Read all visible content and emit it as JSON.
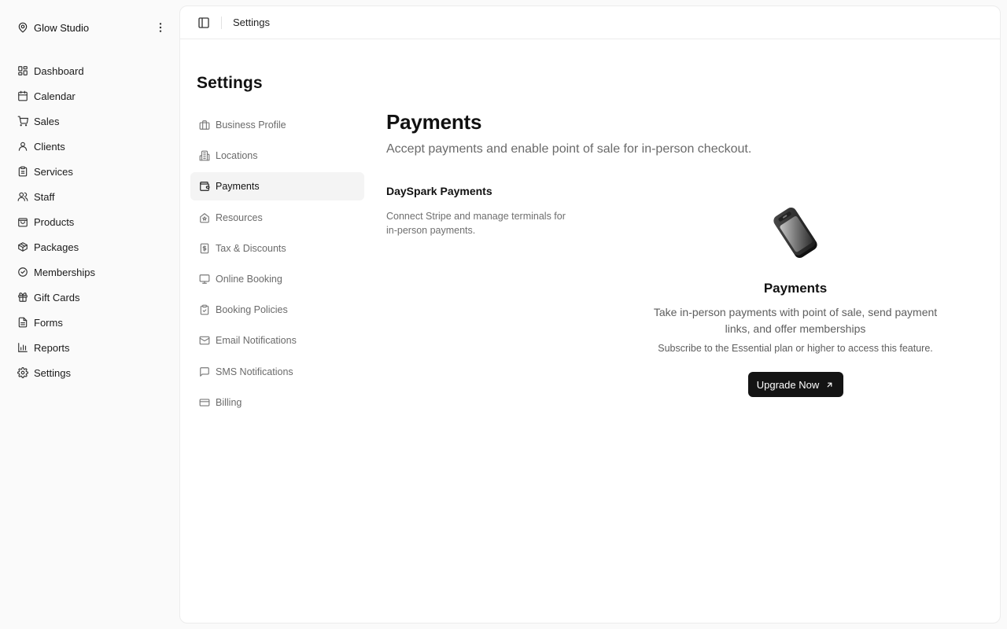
{
  "workspace": {
    "name": "Glow Studio",
    "icon": "map-pin-icon"
  },
  "sidebar": {
    "items": [
      {
        "label": "Dashboard",
        "icon": "dashboard-icon"
      },
      {
        "label": "Calendar",
        "icon": "calendar-icon"
      },
      {
        "label": "Sales",
        "icon": "cart-icon"
      },
      {
        "label": "Clients",
        "icon": "user-icon"
      },
      {
        "label": "Services",
        "icon": "clipboard-icon"
      },
      {
        "label": "Staff",
        "icon": "users-icon"
      },
      {
        "label": "Products",
        "icon": "shopping-bag-icon"
      },
      {
        "label": "Packages",
        "icon": "package-icon"
      },
      {
        "label": "Memberships",
        "icon": "badge-check-icon"
      },
      {
        "label": "Gift Cards",
        "icon": "gift-icon"
      },
      {
        "label": "Forms",
        "icon": "file-text-icon"
      },
      {
        "label": "Reports",
        "icon": "bar-chart-icon"
      },
      {
        "label": "Settings",
        "icon": "gear-icon"
      }
    ]
  },
  "topbar": {
    "breadcrumb": "Settings"
  },
  "settings": {
    "title": "Settings",
    "active": "Payments",
    "items": [
      {
        "label": "Business Profile",
        "icon": "briefcase-icon"
      },
      {
        "label": "Locations",
        "icon": "building-icon"
      },
      {
        "label": "Payments",
        "icon": "wallet-icon"
      },
      {
        "label": "Resources",
        "icon": "resource-house-icon"
      },
      {
        "label": "Tax & Discounts",
        "icon": "receipt-icon"
      },
      {
        "label": "Online Booking",
        "icon": "monitor-icon"
      },
      {
        "label": "Booking Policies",
        "icon": "clipboard-check-icon"
      },
      {
        "label": "Email Notifications",
        "icon": "mail-icon"
      },
      {
        "label": "SMS Notifications",
        "icon": "message-icon"
      },
      {
        "label": "Billing",
        "icon": "credit-card-icon"
      }
    ]
  },
  "page": {
    "title": "Payments",
    "subtitle": "Accept payments and enable point of sale for in-person checkout."
  },
  "section": {
    "title": "DaySpark Payments",
    "description": "Connect Stripe and manage terminals for in-person payments."
  },
  "feature": {
    "title": "Payments",
    "description": "Take in-person payments with point of sale, send payment links, and offer memberships",
    "note": "Subscribe to the Essential plan or higher to access this feature.",
    "button_label": "Upgrade Now",
    "image": "card-terminal-illustration"
  },
  "colors": {
    "primary_button": "#141414",
    "active_item_bg": "#f4f4f4",
    "panel_bg": "#ffffff",
    "app_bg": "#fafafa"
  }
}
